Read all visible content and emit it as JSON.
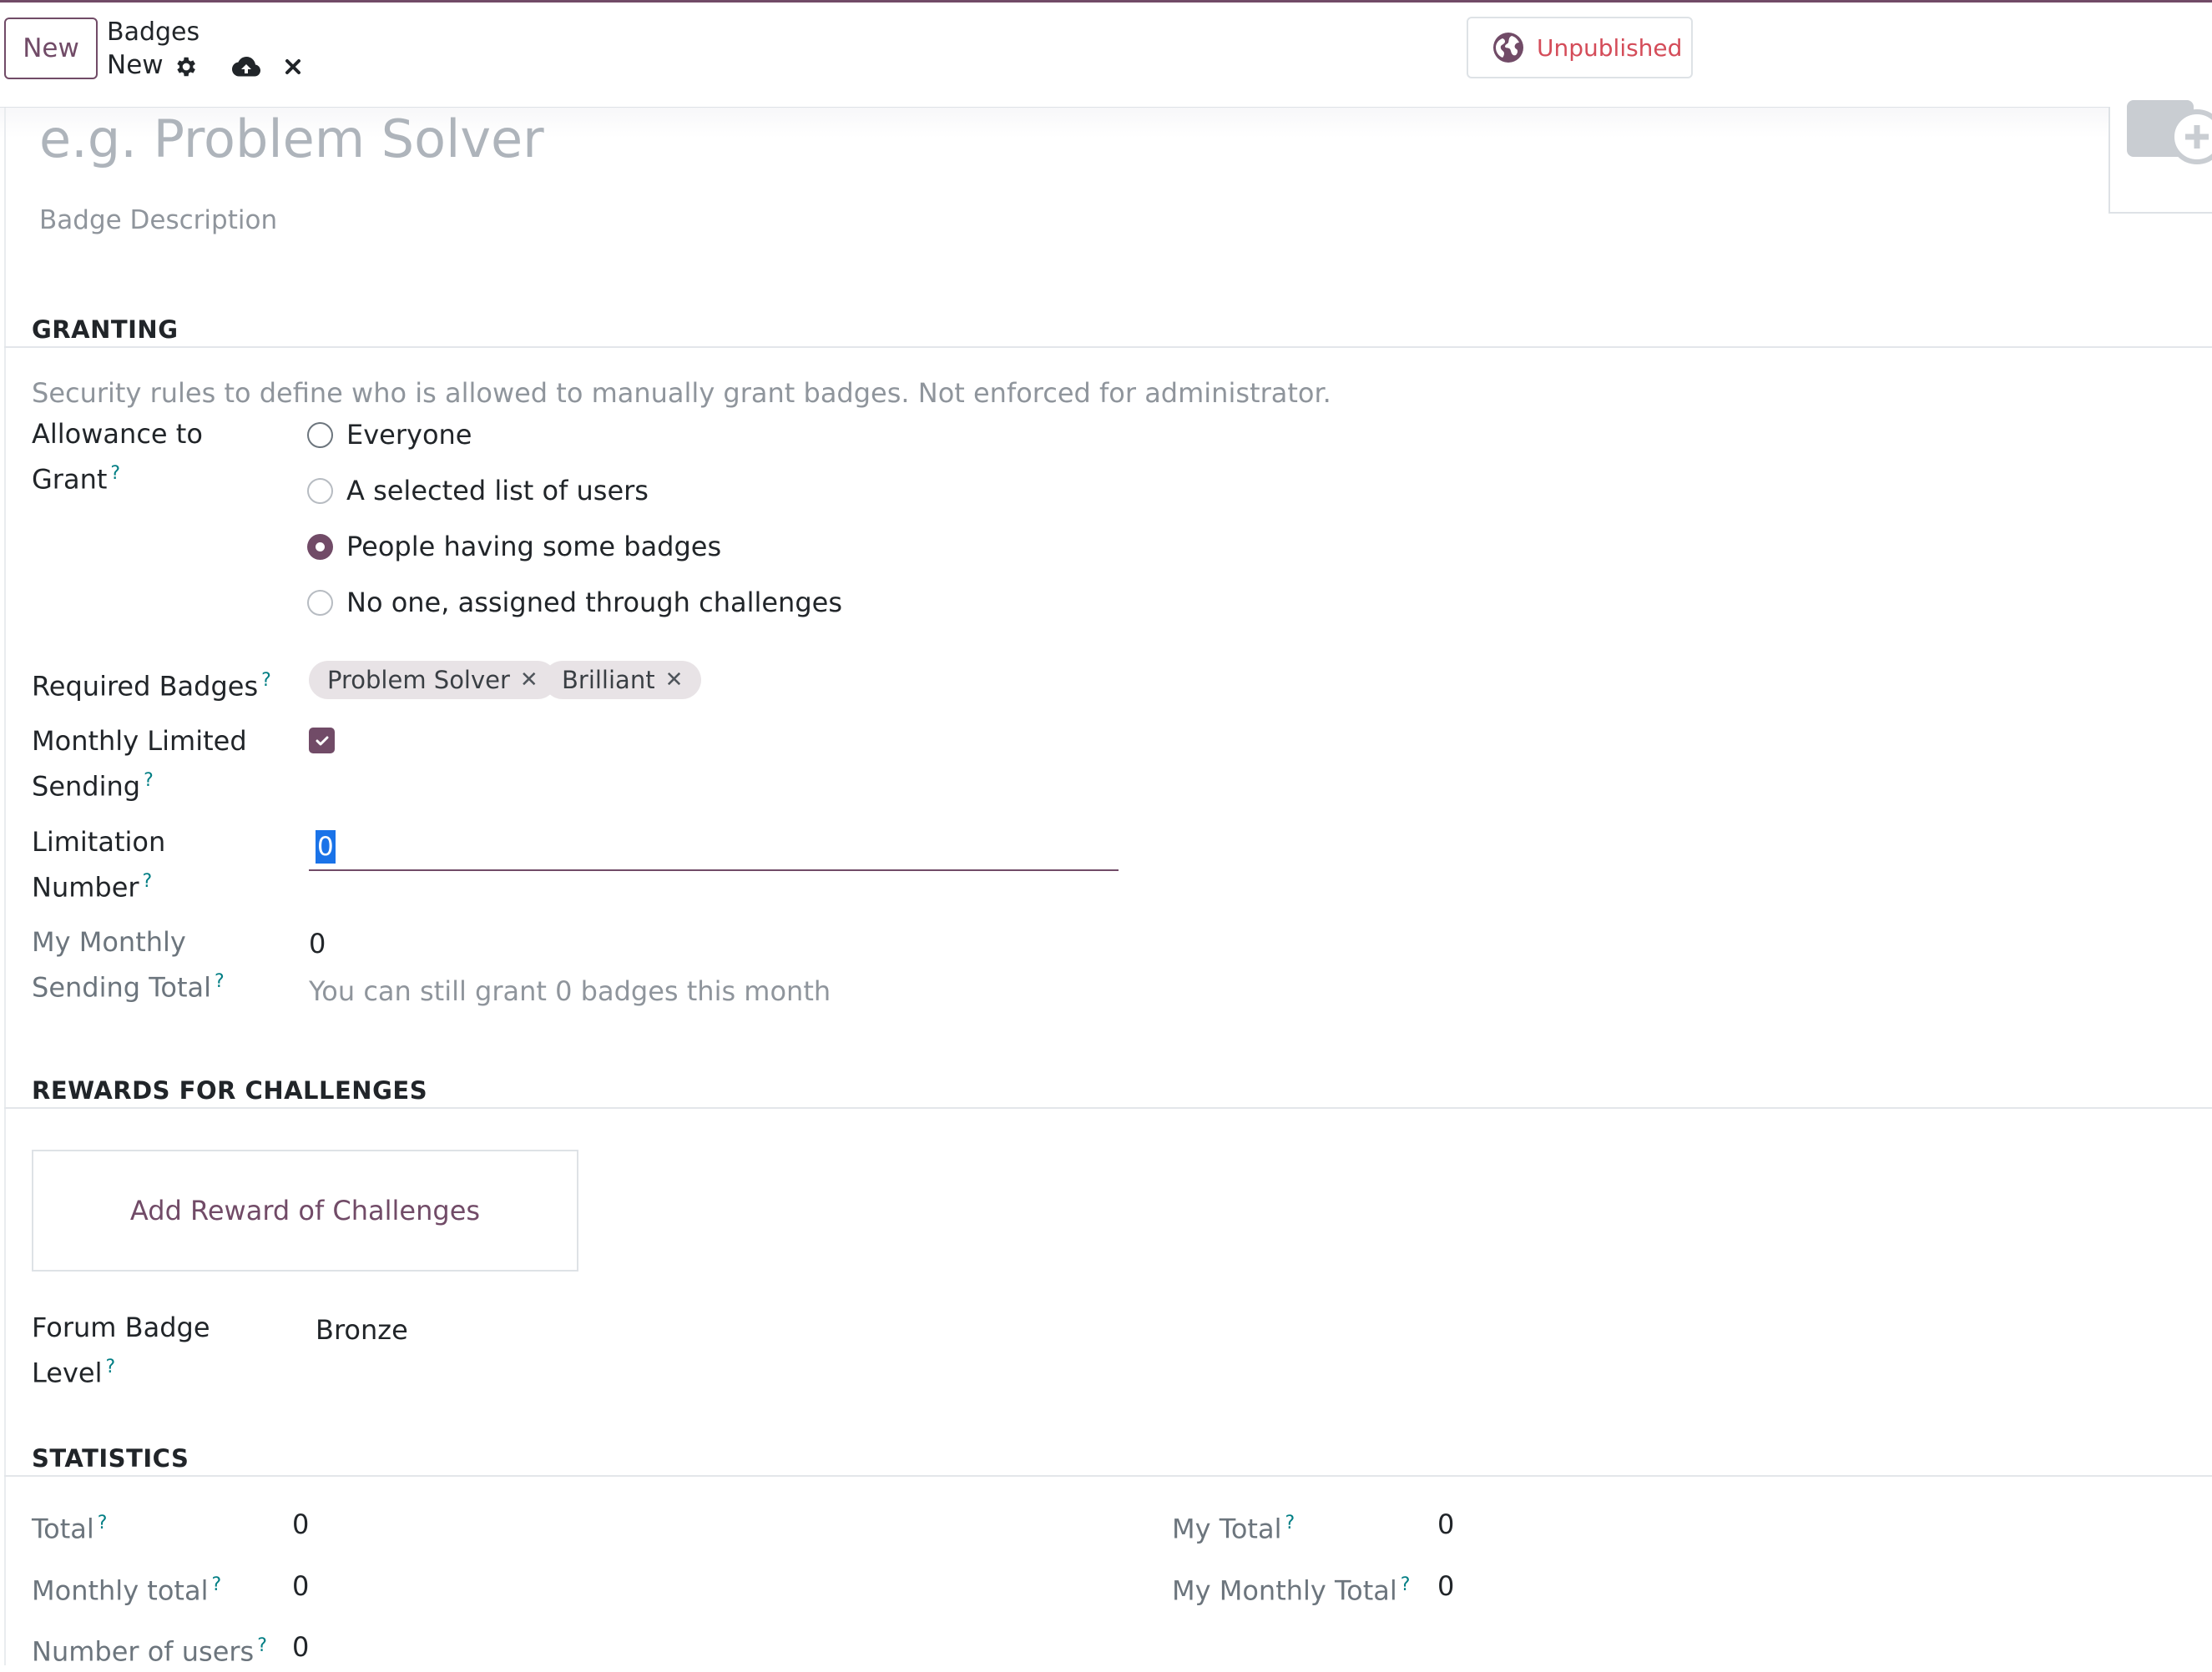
{
  "header": {
    "new_label": "New",
    "breadcrumb_parent": "Badges",
    "breadcrumb_current": "New",
    "publish_label": "Unpublished"
  },
  "form": {
    "name_placeholder": "e.g. Problem Solver",
    "description_placeholder": "Badge Description"
  },
  "granting": {
    "title": "GRANTING",
    "help": "Security rules to define who is allowed to manually grant badges. Not enforced for administrator.",
    "allowance_label_1": "Allowance to",
    "allowance_label_2": "Grant",
    "options": [
      "Everyone",
      "A selected list of users",
      "People having some badges",
      "No one, assigned through challenges"
    ],
    "selected_option": "People having some badges",
    "required_badges_label": "Required Badges",
    "required_badges": [
      "Problem Solver",
      "Brilliant"
    ],
    "monthly_limited_label_1": "Monthly Limited",
    "monthly_limited_label_2": "Sending",
    "monthly_limited_checked": true,
    "limitation_label_1": "Limitation",
    "limitation_label_2": "Number",
    "limitation_value": "0",
    "my_monthly_label_1": "My Monthly",
    "my_monthly_label_2": "Sending Total",
    "my_monthly_value": "0",
    "remaining_hint": "You can still grant 0 badges this month"
  },
  "rewards": {
    "title": "REWARDS FOR CHALLENGES",
    "add_label": "Add Reward of Challenges",
    "forum_level_label_1": "Forum Badge",
    "forum_level_label_2": "Level",
    "forum_level_value": "Bronze"
  },
  "statistics": {
    "title": "STATISTICS",
    "total_label": "Total",
    "total_value": "0",
    "monthly_total_label": "Monthly total",
    "monthly_total_value": "0",
    "users_label": "Number of users",
    "users_value": "0",
    "my_total_label": "My Total",
    "my_total_value": "0",
    "my_monthly_total_label": "My Monthly Total",
    "my_monthly_total_value": "0"
  },
  "help_marker": "?",
  "colors": {
    "primary": "#714b67",
    "danger": "#d44c59",
    "help": "#017e84"
  }
}
